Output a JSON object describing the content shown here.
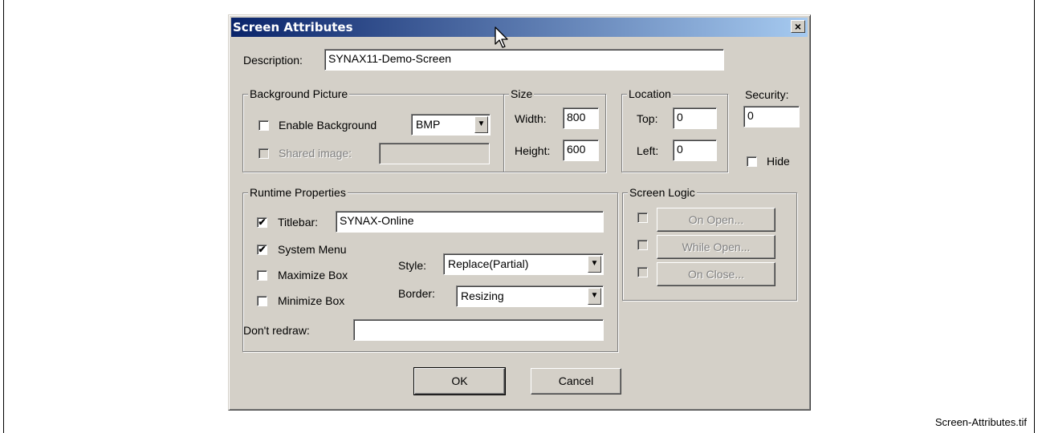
{
  "caption": "Screen-Attributes.tif",
  "dialog": {
    "title": "Screen Attributes",
    "close_label": "×",
    "description_label": "Description:",
    "description_value": "SYNAX11-Demo-Screen",
    "background_picture": {
      "title": "Background Picture",
      "enable_label": "Enable Background",
      "enable_checked": false,
      "format_value": "BMP",
      "shared_label": "Shared image:",
      "shared_value": ""
    },
    "size": {
      "title": "Size",
      "width_label": "Width:",
      "width_value": "800",
      "height_label": "Height:",
      "height_value": "600"
    },
    "location": {
      "title": "Location",
      "top_label": "Top:",
      "top_value": "0",
      "left_label": "Left:",
      "left_value": "0"
    },
    "security": {
      "label": "Security:",
      "value": "0",
      "hide_label": "Hide"
    },
    "runtime": {
      "title": "Runtime Properties",
      "titlebar_label": "Titlebar:",
      "titlebar_value": "SYNAX-Online",
      "system_menu_label": "System Menu",
      "maximize_label": "Maximize Box",
      "minimize_label": "Minimize Box",
      "style_label": "Style:",
      "style_value": "Replace(Partial)",
      "border_label": "Border:",
      "border_value": "Resizing",
      "dont_redraw_label": "Don't redraw:",
      "dont_redraw_value": "",
      "check_mark": "✔"
    },
    "screen_logic": {
      "title": "Screen Logic",
      "on_open": "On Open...",
      "while_open": "While Open...",
      "on_close": "On Close..."
    },
    "ok_label": "OK",
    "cancel_label": "Cancel"
  },
  "colors": {
    "titlebar_start": "#0a246a",
    "titlebar_end": "#a6caf0",
    "face": "#d4d0c8"
  }
}
